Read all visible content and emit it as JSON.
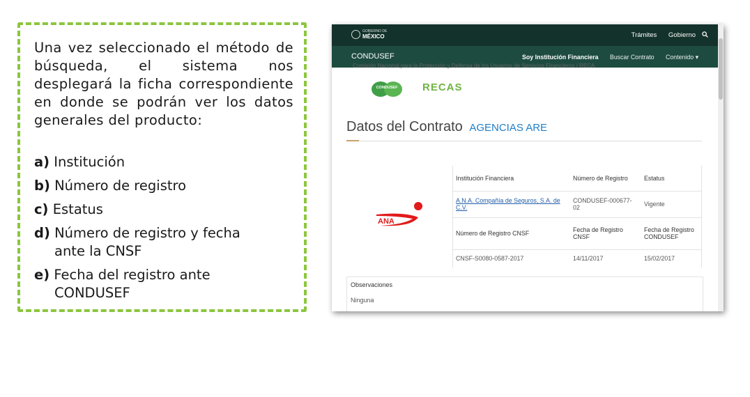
{
  "instructions": {
    "paragraph": "Una vez seleccionado el método de búsqueda, el sistema nos desplegará la ficha correspondiente en donde se podrán ver los datos generales del producto:",
    "items": [
      {
        "key": "a)",
        "text": "Institución"
      },
      {
        "key": "b)",
        "text": "Número de registro"
      },
      {
        "key": "c)",
        "text": "Estatus"
      },
      {
        "key": "d)",
        "text": "Número de registro y fecha",
        "text2": "ante la CNSF"
      },
      {
        "key": "e)",
        "text": "Fecha del registro ante",
        "text2": "CONDUSEF"
      }
    ],
    "border_color": "#8cc63f"
  },
  "browser": {
    "gob_header": {
      "logo_small": "GOBIERNO DE",
      "logo_main": "MÉXICO",
      "nav": [
        "Trámites",
        "Gobierno"
      ],
      "icon": "search-icon"
    },
    "condusef_header": {
      "brand": "CONDUSEF",
      "nav": [
        "Soy Institución Financiera",
        "Buscar Contrato",
        "Contenido ▾"
      ]
    },
    "cut_text": "Comisión Nacional para la Protección y Defensa de los Usuarios de Servicios Financieros / RECA",
    "logos": {
      "condusef": "CONDUSEF",
      "reca": "RECAS"
    },
    "section": {
      "title": "Datos del Contrato",
      "agency": "AGENCIAS ARE"
    },
    "table": {
      "header1": [
        "Institución Financiera",
        "Número de Registro",
        "Estatus"
      ],
      "row1": [
        "A.N.A. Compañía de Seguros, S.A. de C.V.",
        "CONDUSEF-000677-02",
        "Vigente"
      ],
      "header2": [
        "Número de Registro CNSF",
        "Fecha de Registro CNSF",
        "Fecha de Registro CONDUSEF"
      ],
      "row2": [
        "CNSF-S0080-0587-2017",
        "14/11/2017",
        "15/02/2017"
      ]
    },
    "ana_logo_text": "ANA",
    "observations": {
      "title": "Observaciones",
      "value": "Ninguna"
    },
    "colors": {
      "gob_bar": "#13322b",
      "condusef_bar": "#1e4b40",
      "agency": "#1f7fc9",
      "ana_red": "#e21b1b"
    }
  }
}
